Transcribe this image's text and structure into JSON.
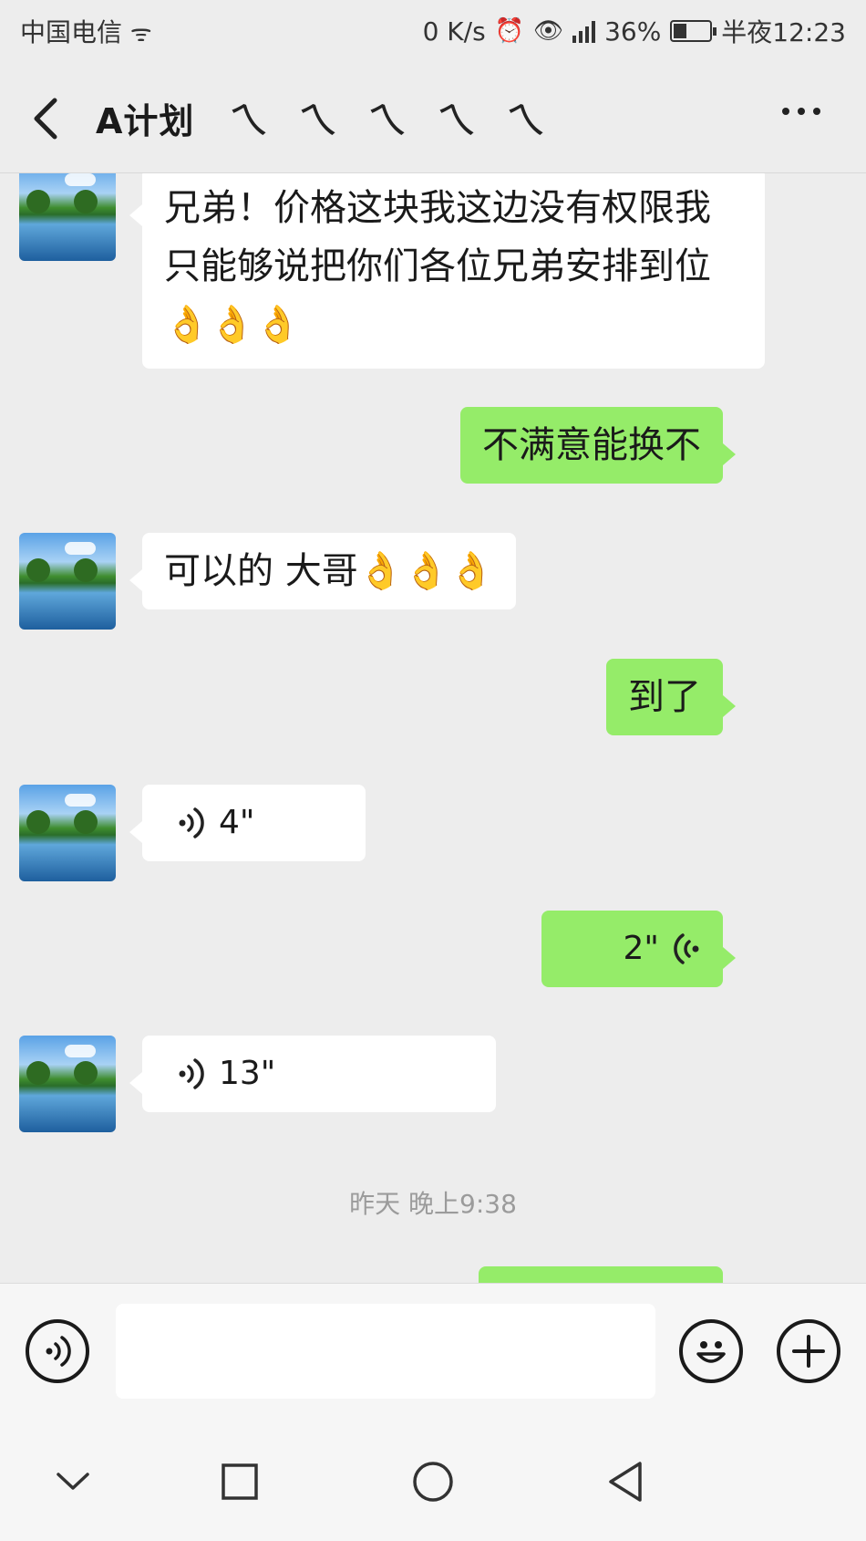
{
  "status_bar": {
    "carrier": "中国电信",
    "net_speed": "0 K/s",
    "battery_pct": "36%",
    "battery_level": 0.36,
    "time": "半夜12:23"
  },
  "header": {
    "title": "A计划",
    "title_decoration": "ㄟㄟㄟㄟㄟ",
    "back_icon": "chevron-left-icon",
    "more_icon": "more-horizontal-icon"
  },
  "messages": [
    {
      "side": "in",
      "type": "text",
      "text": "兄弟！价格这块我这边没有权限我只能够说把你们各位兄弟安排到位👌👌👌"
    },
    {
      "side": "out",
      "type": "text",
      "text": "不满意能换不"
    },
    {
      "side": "in",
      "type": "text",
      "text": "可以的 大哥👌👌👌"
    },
    {
      "side": "out",
      "type": "text",
      "text": "到了"
    },
    {
      "side": "in",
      "type": "voice",
      "duration": "4\""
    },
    {
      "side": "out",
      "type": "voice",
      "duration": "2\""
    },
    {
      "side": "in",
      "type": "voice",
      "duration": "13\""
    }
  ],
  "timestamp": "昨天 晚上9:38",
  "input": {
    "value": "",
    "placeholder": ""
  },
  "colors": {
    "background": "#ededed",
    "outgoing_bubble": "#95ec69",
    "incoming_bubble": "#ffffff"
  }
}
